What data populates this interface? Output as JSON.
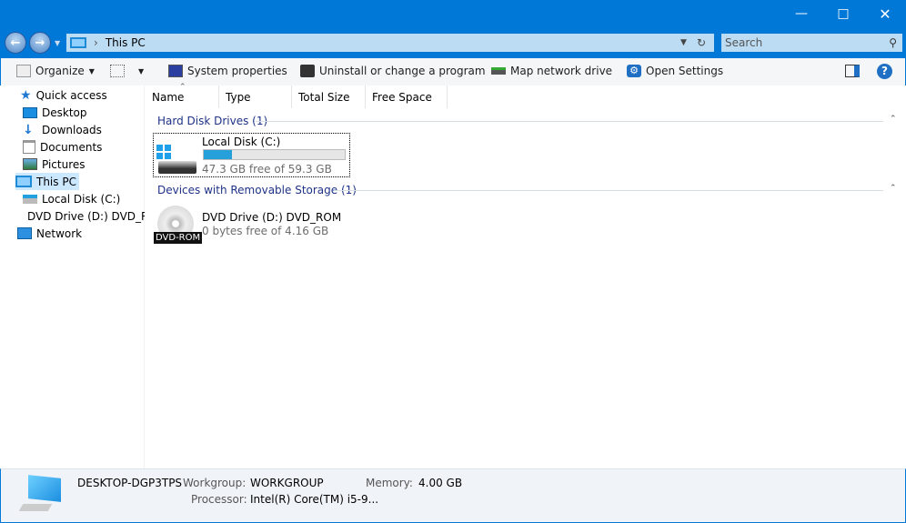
{
  "window": {
    "minimize_icon": "minimize",
    "maximize_icon": "maximize",
    "close_icon": "close"
  },
  "address": {
    "path": "This PC",
    "search_placeholder": "Search"
  },
  "toolbar": {
    "organize": "Organize",
    "system_properties": "System properties",
    "uninstall": "Uninstall or change a program",
    "map_drive": "Map network drive",
    "open_settings": "Open Settings"
  },
  "sidebar": {
    "items": [
      {
        "label": "Quick access",
        "icon": "star"
      },
      {
        "label": "Desktop",
        "icon": "desktop"
      },
      {
        "label": "Downloads",
        "icon": "download"
      },
      {
        "label": "Documents",
        "icon": "documents"
      },
      {
        "label": "Pictures",
        "icon": "pictures"
      },
      {
        "label": "This PC",
        "icon": "computer"
      },
      {
        "label": "Local Disk (C:)",
        "icon": "drive"
      },
      {
        "label": "DVD Drive (D:) DVD_ROM",
        "icon": "dvd"
      },
      {
        "label": "Network",
        "icon": "network"
      }
    ]
  },
  "columns": [
    "Name",
    "Type",
    "Total Size",
    "Free Space"
  ],
  "groups": [
    {
      "title": "Hard Disk Drives (1)",
      "items": [
        {
          "name": "Local Disk (C:)",
          "detail": "47.3 GB free of 59.3 GB",
          "used_fraction": 0.2
        }
      ]
    },
    {
      "title": "Devices with Removable Storage (1)",
      "items": [
        {
          "name": "DVD Drive (D:) DVD_ROM",
          "detail": "0 bytes free of 4.16 GB",
          "badge": "DVD-ROM"
        }
      ]
    }
  ],
  "details": {
    "computer_name": "DESKTOP-DGP3TPS",
    "workgroup_label": "Workgroup:",
    "workgroup": "WORKGROUP",
    "memory_label": "Memory:",
    "memory": "4.00 GB",
    "processor_label": "Processor:",
    "processor": "Intel(R) Core(TM) i5-9..."
  },
  "colors": {
    "accent": "#0078d7",
    "progress": "#26a0da"
  }
}
